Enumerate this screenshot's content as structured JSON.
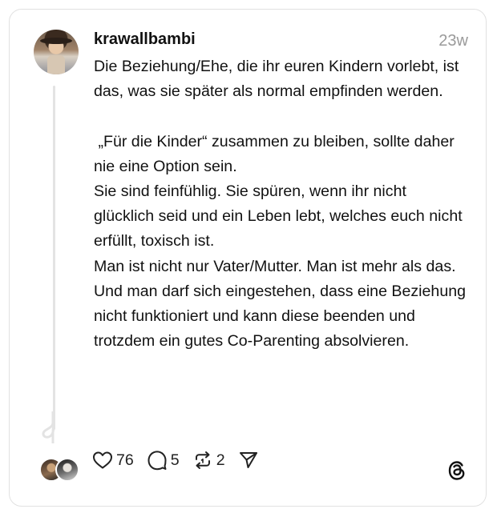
{
  "post": {
    "username": "krawallbambi",
    "timestamp": "23w",
    "text": "Die Beziehung/Ehe, die ihr euren Kindern vorlebt, ist das, was sie später als normal empfinden werden.\n\n „Für die Kinder“ zusammen zu bleiben, sollte daher nie eine Option sein.\nSie sind feinfühlig. Sie spüren, wenn ihr nicht glücklich seid und ein Leben lebt, welches euch nicht erfüllt, toxisch ist.\nMan ist nicht nur Vater/Mutter. Man ist mehr als das.\nUnd man darf sich eingestehen, dass eine Beziehung nicht funktioniert und kann diese beenden und trotzdem ein gutes Co-Parenting absolvieren."
  },
  "actions": {
    "likes": "76",
    "replies": "5",
    "reposts": "2"
  },
  "icons": {
    "like": "heart-icon",
    "reply": "comment-icon",
    "repost": "repost-icon",
    "share": "send-icon",
    "brand": "threads-logo-icon"
  },
  "colors": {
    "text": "#111111",
    "muted": "#9a9a9a",
    "border": "#e1e1e1"
  }
}
